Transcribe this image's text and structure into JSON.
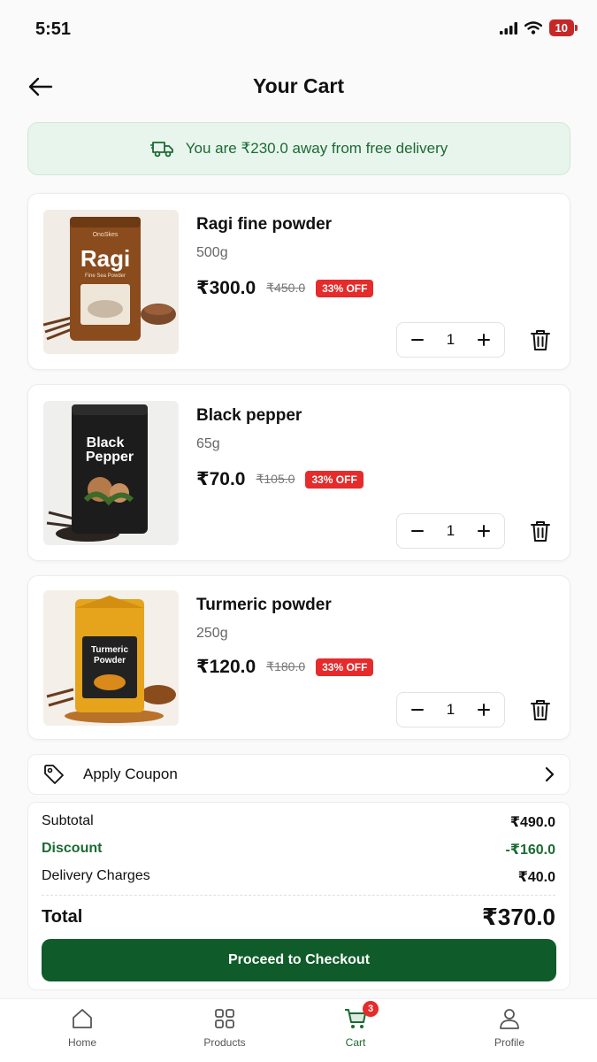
{
  "status_bar": {
    "time": "5:51",
    "battery": "10"
  },
  "header": {
    "title": "Your Cart"
  },
  "delivery_banner": {
    "text": "You are ₹230.0 away from free delivery"
  },
  "items": [
    {
      "name": "Ragi fine powder",
      "weight": "500g",
      "price": "₹300.0",
      "mrp": "₹450.0",
      "discount": "33% OFF",
      "qty": "1",
      "pack_label_line1": "Ragi",
      "pack_label_line2": "",
      "pack_color": "#8a4b1d",
      "brand": "OnoSkes",
      "pack_sub": "Fine Sea Powder"
    },
    {
      "name": "Black pepper",
      "weight": "65g",
      "price": "₹70.0",
      "mrp": "₹105.0",
      "discount": "33% OFF",
      "qty": "1",
      "pack_label_line1": "Black",
      "pack_label_line2": "Pepper",
      "pack_color": "#1c1c1c",
      "brand": "",
      "pack_sub": ""
    },
    {
      "name": "Turmeric powder",
      "weight": "250g",
      "price": "₹120.0",
      "mrp": "₹180.0",
      "discount": "33% OFF",
      "qty": "1",
      "pack_label_line1": "Turmeric",
      "pack_label_line2": "Powder",
      "pack_color": "#e6a31c",
      "brand": "",
      "pack_sub": ""
    }
  ],
  "coupon": {
    "label": "Apply Coupon"
  },
  "summary": {
    "subtotal_label": "Subtotal",
    "subtotal": "₹490.0",
    "discount_label": "Discount",
    "discount": "-₹160.0",
    "delivery_label": "Delivery Charges",
    "delivery": "₹40.0",
    "total_label": "Total",
    "total": "₹370.0",
    "checkout_label": "Proceed to Checkout"
  },
  "nav": {
    "items": [
      {
        "label": "Home",
        "icon": "home-icon"
      },
      {
        "label": "Products",
        "icon": "grid-icon"
      },
      {
        "label": "Cart",
        "icon": "cart-icon",
        "badge": "3"
      },
      {
        "label": "Profile",
        "icon": "person-icon"
      }
    ]
  },
  "colors": {
    "primary": "#0f5b2a",
    "accent_green": "#1b6b33",
    "badge_red": "#e52b2b"
  }
}
